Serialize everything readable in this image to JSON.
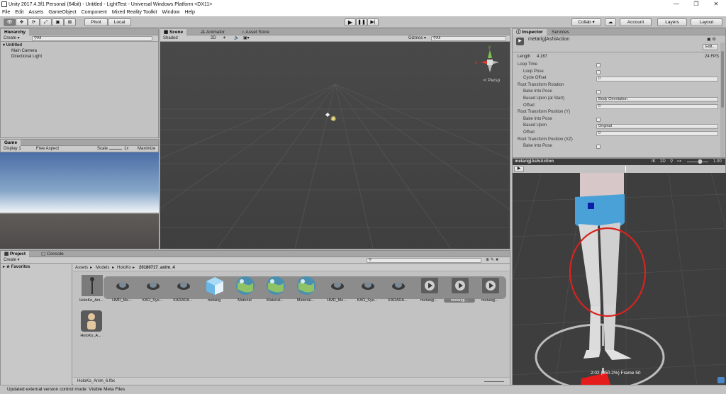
{
  "window": {
    "title": "Unity 2017.4.3f1 Personal (64bit) - Untitled - LightTest - Universal Windows Platform <DX11>",
    "minimize": "—",
    "maximize": "❐",
    "close": "✕"
  },
  "menu": [
    "File",
    "Edit",
    "Assets",
    "GameObject",
    "Component",
    "Mixed Reality Toolkit",
    "Window",
    "Help"
  ],
  "toolbar": {
    "pivot": "Pivot",
    "local": "Local",
    "collab": "Collab ▾",
    "account": "Account",
    "layers": "Layers",
    "layout": "Layout"
  },
  "hierarchy": {
    "tab": "Hierarchy",
    "create": "Create ▾",
    "search_placeholder": "All",
    "scene_name": "Untitled",
    "items": [
      "Main Camera",
      "Directional Light"
    ]
  },
  "game": {
    "tab": "Game",
    "display": "Display 1",
    "aspect": "Free Aspect",
    "scale_label": "Scale",
    "scale_value": "1x",
    "maximize": "Maximize"
  },
  "scene": {
    "tabs": [
      "Scene",
      "Animator",
      "Asset Store"
    ],
    "shading": "Shaded",
    "mode_2d": "2D",
    "gizmos": "Gizmos ▾",
    "search_placeholder": "All",
    "persp": "Persp",
    "gizmo_labels": {
      "y": "y",
      "x": "x"
    }
  },
  "inspector": {
    "tabs": [
      "Inspector",
      "Services"
    ],
    "object_name": "metarig|AshiAction",
    "edit_button": "Edit...",
    "length_label": "Length",
    "length_value": "4.167",
    "fps": "24 FPS",
    "rows": [
      {
        "label": "Loop Time",
        "indent": false,
        "type": "check"
      },
      {
        "label": "Loop Pose",
        "indent": true,
        "type": "check"
      },
      {
        "label": "Cycle Offset",
        "indent": true,
        "type": "field",
        "value": "0"
      },
      {
        "label": "Root Transform Rotation",
        "indent": false,
        "type": "none"
      },
      {
        "label": "Bake Into Pose",
        "indent": true,
        "type": "check"
      },
      {
        "label": "Based Upon (at Start)",
        "indent": true,
        "type": "dropdown",
        "value": "Body Orientation"
      },
      {
        "label": "Offset",
        "indent": true,
        "type": "field",
        "value": "0"
      },
      {
        "label": "Root Transform Position (Y)",
        "indent": false,
        "type": "none"
      },
      {
        "label": "Bake Into Pose",
        "indent": true,
        "type": "check"
      },
      {
        "label": "Based Upon",
        "indent": true,
        "type": "dropdown",
        "value": "Original"
      },
      {
        "label": "Offset",
        "indent": true,
        "type": "field",
        "value": "0"
      },
      {
        "label": "Root Transform Position (XZ)",
        "indent": false,
        "type": "none"
      },
      {
        "label": "Bake Into Pose",
        "indent": true,
        "type": "check"
      }
    ]
  },
  "preview": {
    "title": "metarig|AshiAction",
    "ik": "IK",
    "mode_2d": "2D",
    "speed": "1.00",
    "status": "2:02 (050.2%) Frame 50"
  },
  "project": {
    "tabs": [
      "Project",
      "Console"
    ],
    "create": "Create ▾",
    "favorites": "Favorites",
    "breadcrumb": [
      "Assets",
      "Models",
      "HoloKo",
      "20180717_anim_4"
    ],
    "assets": [
      {
        "label": "HoloKo_Ani...",
        "icon": "armature-icon"
      },
      {
        "label": "HMD_Me...",
        "icon": "mesh-icon"
      },
      {
        "label": "KAO_Sye...",
        "icon": "mesh-icon"
      },
      {
        "label": "KARADA...",
        "icon": "mesh-icon"
      },
      {
        "label": "metarig",
        "icon": "cube-icon"
      },
      {
        "label": "Material",
        "icon": "material-icon"
      },
      {
        "label": "Material...",
        "icon": "material-icon"
      },
      {
        "label": "Material...",
        "icon": "material-icon"
      },
      {
        "label": "HMD_Me...",
        "icon": "mesh-icon"
      },
      {
        "label": "KAO_Sye...",
        "icon": "mesh-icon"
      },
      {
        "label": "KARADA...",
        "icon": "mesh-icon"
      },
      {
        "label": "metarig|...",
        "icon": "animation-icon"
      },
      {
        "label": "metarig|...",
        "icon": "animation-icon"
      },
      {
        "label": "metarig|...",
        "icon": "animation-icon"
      }
    ],
    "avatar_asset": "HoloKo_A...",
    "selected_file": "HoloKo_Anim_6.fbx"
  },
  "status": "Updated external version control mode: Visible Meta Files"
}
